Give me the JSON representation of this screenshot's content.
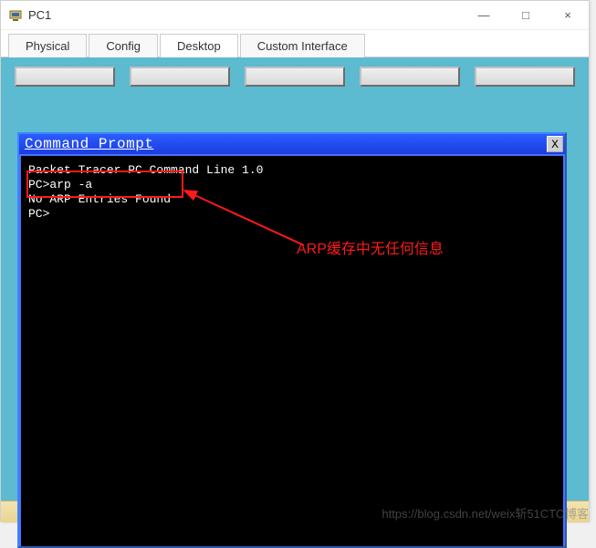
{
  "window": {
    "title": "PC1",
    "controls": {
      "min": "—",
      "max": "□",
      "close": "×"
    }
  },
  "tabs": [
    "Physical",
    "Config",
    "Desktop",
    "Custom Interface"
  ],
  "active_tab": 2,
  "cmd": {
    "title": "Command Prompt",
    "close": "X",
    "lines": [
      "Packet Tracer PC Command Line 1.0",
      "PC>arp -a",
      "No ARP Entries Found",
      "PC>"
    ]
  },
  "annotation": "ARP缓存中无任何信息",
  "watermark": "https://blog.csdn.net/weix斩51CTO博客",
  "colors": {
    "desktop_bg": "#5cbad1",
    "cmd_title_bg": "#2c5cff",
    "highlight": "#ff1a1a"
  }
}
